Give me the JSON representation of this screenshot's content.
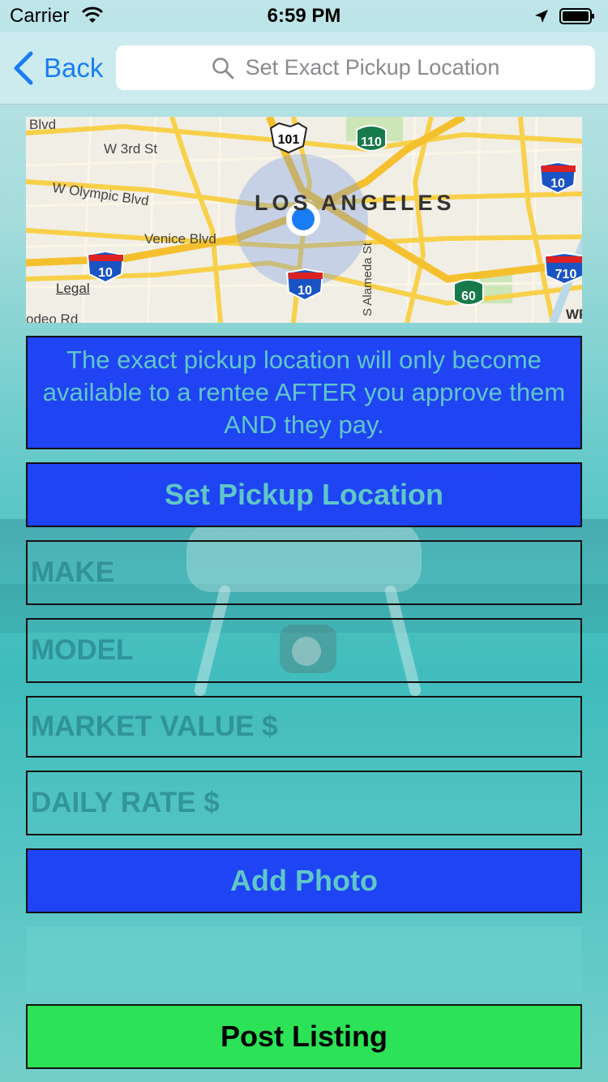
{
  "status_bar": {
    "carrier": "Carrier",
    "time": "6:59 PM",
    "icons": [
      "wifi-icon",
      "location-arrow-icon",
      "battery-icon"
    ]
  },
  "nav": {
    "back_label": "Back",
    "search_placeholder": "Set Exact Pickup Location"
  },
  "map": {
    "city_label": "Los Angeles",
    "streets": [
      "Blvd",
      "W 3rd St",
      "W Olympic Blvd",
      "Venice Blvd",
      "S Alameda St",
      "odeo Rd"
    ],
    "shields": [
      "101",
      "110",
      "10",
      "10",
      "10",
      "710",
      "60"
    ],
    "corner_label": "WF",
    "legal_link": "Legal"
  },
  "info_text": "The exact pickup location will only become available to a rentee AFTER you approve them AND they pay.",
  "buttons": {
    "set_pickup": "Set Pickup Location",
    "add_photo": "Add Photo",
    "post_listing": "Post Listing"
  },
  "fields": {
    "make": "MAKE",
    "model": "MODEL",
    "market_value": "MARKET VALUE $",
    "daily_rate": "DAILY RATE $"
  },
  "colors": {
    "accent_blue": "#1c3ef5",
    "post_green": "#2ce257",
    "label_teal": "#5fc7c9",
    "ios_blue": "#1a7cf5"
  }
}
